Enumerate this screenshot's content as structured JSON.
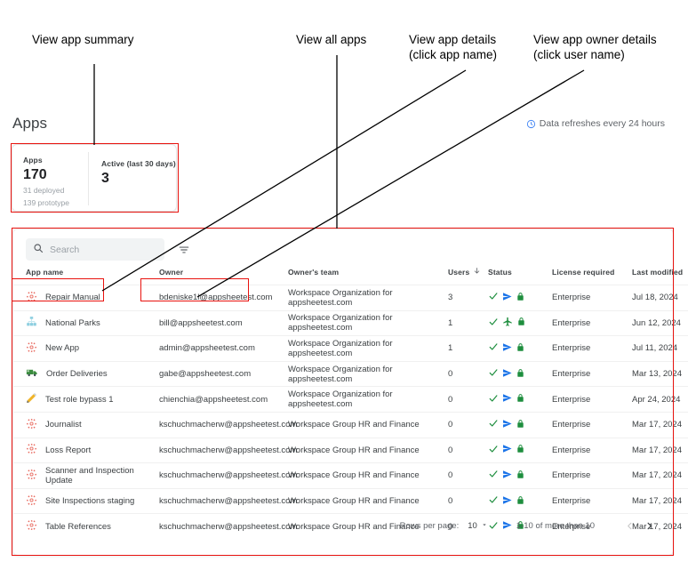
{
  "annotations": [
    {
      "id": "view-app-summary",
      "text_lines": [
        "View app summary"
      ]
    },
    {
      "id": "view-all-apps",
      "text_lines": [
        "View all apps"
      ]
    },
    {
      "id": "view-app-details",
      "text_lines": [
        "View app details",
        "(click app name)"
      ]
    },
    {
      "id": "view-app-owner-details",
      "text_lines": [
        "View app owner details",
        "(click user name)"
      ]
    }
  ],
  "header": {
    "title": "Apps",
    "refresh_note": "Data refreshes every 24 hours",
    "refresh_icon": "clock-icon",
    "refresh_icon_color": "#4285f4"
  },
  "summary": {
    "apps_label": "Apps",
    "apps_value": "170",
    "apps_sub_1": "31 deployed",
    "apps_sub_2": "139 prototype",
    "active_label": "Active (last 30 days)",
    "active_value": "3"
  },
  "search": {
    "placeholder": "Search",
    "value": "",
    "search_icon": "search-icon",
    "filter_icon": "filter-list-icon"
  },
  "table": {
    "columns": [
      {
        "key": "app",
        "label": "App name"
      },
      {
        "key": "owner",
        "label": "Owner"
      },
      {
        "key": "team",
        "label": "Owner's team"
      },
      {
        "key": "users",
        "label": "Users",
        "sort_icon": "arrow-down-icon",
        "sorted": true
      },
      {
        "key": "status",
        "label": "Status"
      },
      {
        "key": "lic",
        "label": "License required"
      },
      {
        "key": "mod",
        "label": "Last modified"
      }
    ],
    "rows": [
      {
        "icon": "appsheet-gear-icon",
        "icon_color": "#e8685d",
        "app": "Repair Manual",
        "owner": "bdeniske1l@appsheetest.com",
        "team": "Workspace Organization for appsheetest.com",
        "users": "3",
        "status": [
          "check-icon",
          "send-icon",
          "lock-icon"
        ],
        "lic": "Enterprise",
        "mod": "Jul 18, 2024"
      },
      {
        "icon": "org-chart-icon",
        "icon_color": "#8ecfe0",
        "app": "National Parks",
        "owner": "bill@appsheetest.com",
        "team": "Workspace Organization for appsheetest.com",
        "users": "1",
        "status": [
          "check-icon",
          "airplane-icon",
          "lock-icon"
        ],
        "lic": "Enterprise",
        "mod": "Jun 12, 2024"
      },
      {
        "icon": "appsheet-gear-icon",
        "icon_color": "#e8685d",
        "app": "New App",
        "owner": "admin@appsheetest.com",
        "team": "Workspace Organization for appsheetest.com",
        "users": "1",
        "status": [
          "check-icon",
          "send-icon",
          "lock-icon"
        ],
        "lic": "Enterprise",
        "mod": "Jul 11, 2024"
      },
      {
        "icon": "truck-icon",
        "icon_color": "#3b8c3f",
        "app": "Order Deliveries",
        "owner": "gabe@appsheetest.com",
        "team": "Workspace Organization for appsheetest.com",
        "users": "0",
        "status": [
          "check-icon",
          "send-icon",
          "lock-icon"
        ],
        "lic": "Enterprise",
        "mod": "Mar 13, 2024"
      },
      {
        "icon": "pencil-icon",
        "icon_color": "#f0b429",
        "app": "Test role bypass 1",
        "owner": "chienchia@appsheetest.com",
        "team": "Workspace Organization for appsheetest.com",
        "users": "0",
        "status": [
          "check-icon",
          "send-icon",
          "lock-icon"
        ],
        "lic": "Enterprise",
        "mod": "Apr 24, 2024"
      },
      {
        "icon": "appsheet-gear-icon",
        "icon_color": "#e8685d",
        "app": "Journalist",
        "owner": "kschuchmacherw@appsheetest.com",
        "team": "Workspace Group HR and Finance",
        "users": "0",
        "status": [
          "check-icon",
          "send-icon",
          "lock-icon"
        ],
        "lic": "Enterprise",
        "mod": "Mar 17, 2024"
      },
      {
        "icon": "appsheet-gear-icon",
        "icon_color": "#e8685d",
        "app": "Loss Report",
        "owner": "kschuchmacherw@appsheetest.com",
        "team": "Workspace Group HR and Finance",
        "users": "0",
        "status": [
          "check-icon",
          "send-icon",
          "lock-icon"
        ],
        "lic": "Enterprise",
        "mod": "Mar 17, 2024"
      },
      {
        "icon": "appsheet-gear-icon",
        "icon_color": "#e8685d",
        "app": "Scanner and Inspection Update",
        "owner": "kschuchmacherw@appsheetest.com",
        "team": "Workspace Group HR and Finance",
        "users": "0",
        "status": [
          "check-icon",
          "send-icon",
          "lock-icon"
        ],
        "lic": "Enterprise",
        "mod": "Mar 17, 2024"
      },
      {
        "icon": "appsheet-gear-icon",
        "icon_color": "#e8685d",
        "app": "Site Inspections staging",
        "owner": "kschuchmacherw@appsheetest.com",
        "team": "Workspace Group HR and Finance",
        "users": "0",
        "status": [
          "check-icon",
          "send-icon",
          "lock-icon"
        ],
        "lic": "Enterprise",
        "mod": "Mar 17, 2024"
      },
      {
        "icon": "appsheet-gear-icon",
        "icon_color": "#e8685d",
        "app": "Table References",
        "owner": "kschuchmacherw@appsheetest.com",
        "team": "Workspace Group HR and Finance",
        "users": "0",
        "status": [
          "check-icon",
          "send-icon",
          "lock-icon"
        ],
        "lic": "Enterprise",
        "mod": "Mar 17, 2024"
      }
    ]
  },
  "pagination": {
    "rows_per_page_label": "Rows per page:",
    "rows_per_page_value": "10",
    "range_label": "1-10 of more than 10",
    "prev_icon": "chevron-left-icon",
    "next_icon": "chevron-right-icon"
  },
  "colors": {
    "highlight": "#e8120e",
    "status_check": "#1e8e3e",
    "status_send": "#1a73e8",
    "status_lock": "#1e8e3e",
    "accent_blue": "#4285f4"
  }
}
